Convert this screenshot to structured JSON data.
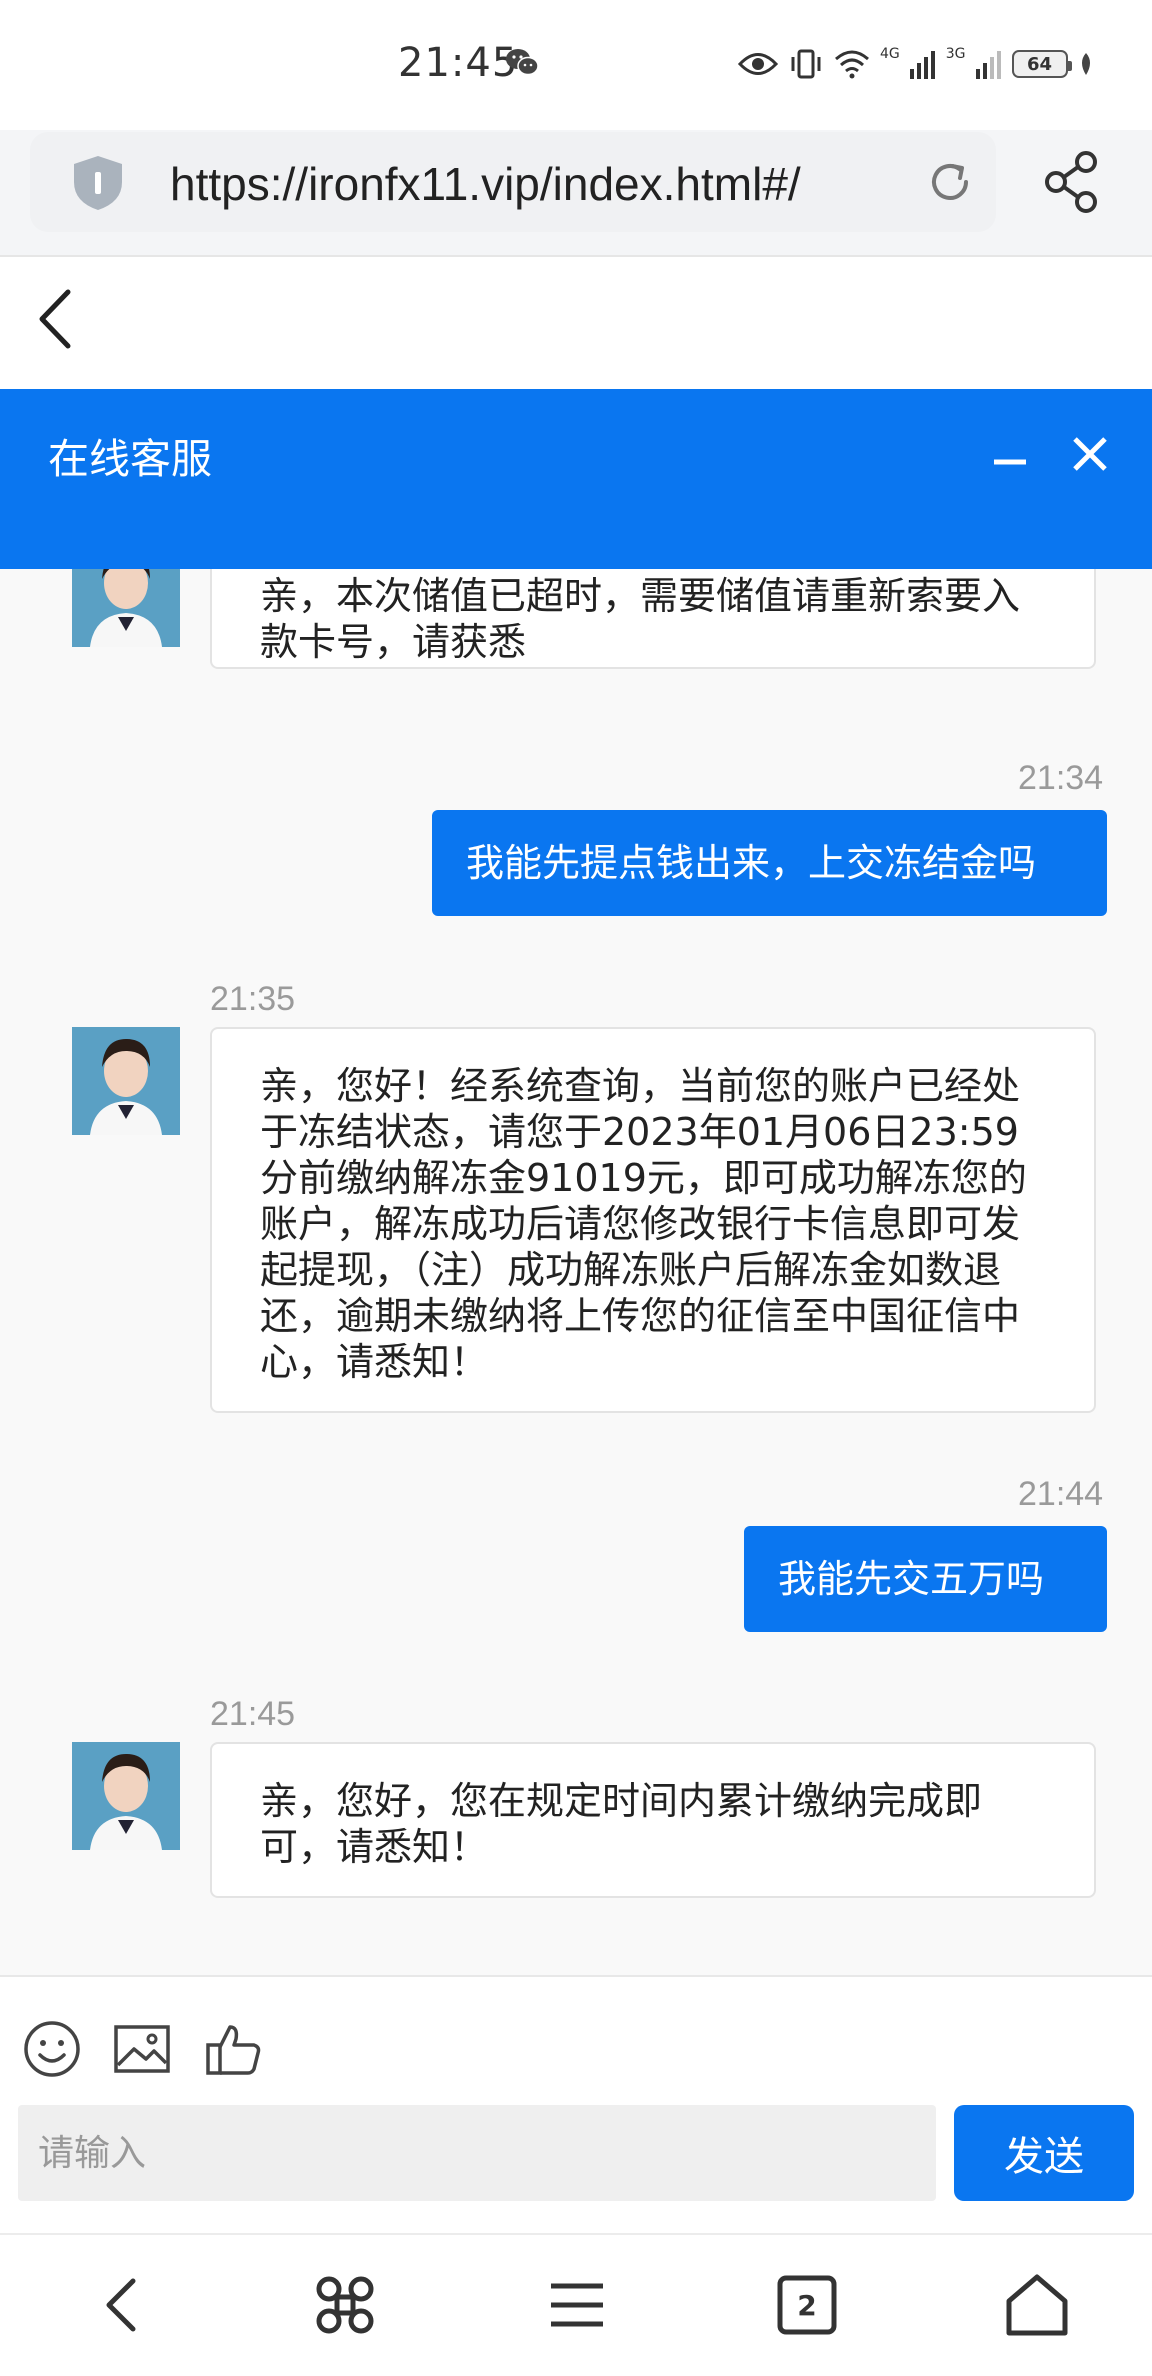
{
  "status_bar": {
    "time": "21:45",
    "network_1": "4G",
    "network_2": "3G",
    "battery": "64"
  },
  "browser": {
    "url": "https://ironfx11.vip/index.html#/"
  },
  "chat": {
    "title": "在线客服",
    "messages": [
      {
        "side": "in",
        "time": "",
        "text": "亲，本次储值已超时，需要储值请重新索要入款卡号，请获悉"
      },
      {
        "side": "out",
        "time": "21:34",
        "text": "我能先提点钱出来，上交冻结金吗"
      },
      {
        "side": "in",
        "time": "21:35",
        "text": "亲，您好！经系统查询，当前您的账户已经处于冻结状态，请您于2023年01月06日23:59分前缴纳解冻金91019元，即可成功解冻您的账户，解冻成功后请您修改银行卡信息即可发起提现，（注）成功解冻账户后解冻金如数退还，逾期未缴纳将上传您的征信至中国征信中心，请悉知！"
      },
      {
        "side": "out",
        "time": "21:44",
        "text": "我能先交五万吗"
      },
      {
        "side": "in",
        "time": "21:45",
        "text": "亲，您好，您在规定时间内累计缴纳完成即可，请悉知！"
      }
    ]
  },
  "input": {
    "placeholder": "请输入",
    "send_label": "发送"
  },
  "bottom_nav": {
    "tab_count": "2"
  },
  "colors": {
    "accent": "#0a76f0",
    "bubble_in_bg": "#ffffff",
    "bubble_out_bg": "#0a76f0"
  },
  "icons": [
    "wechat-icon",
    "eye-icon",
    "vibrate-icon",
    "wifi-icon",
    "signal-icon",
    "battery-icon",
    "shield-icon",
    "reload-icon",
    "share-icon",
    "back-icon",
    "minimize-icon",
    "close-icon",
    "emoji-icon",
    "image-icon",
    "thumbs-up-icon",
    "nav-back-icon",
    "command-icon",
    "menu-icon",
    "tabs-icon",
    "home-icon"
  ]
}
